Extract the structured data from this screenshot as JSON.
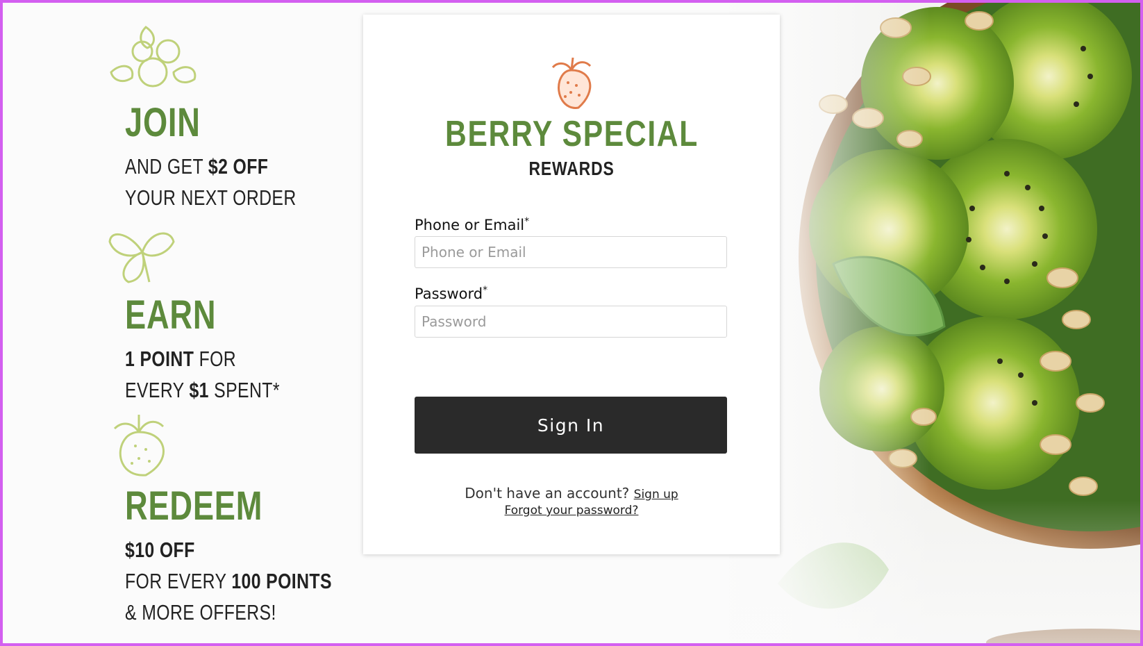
{
  "brand": {
    "title": "BERRY SPECIAL",
    "subtitle": "REWARDS",
    "logo_icon": "strawberry-icon",
    "accent_color": "#5d8a3c",
    "logo_color": "#e07b4a"
  },
  "promo": {
    "join": {
      "heading": "JOIN",
      "line1_a": "AND GET ",
      "line1_b": "$2 OFF",
      "line2": "YOUR NEXT ORDER",
      "icon": "blueberry-icon"
    },
    "earn": {
      "heading": "EARN",
      "line1_a": "1 POINT",
      "line1_b": " FOR",
      "line2_a": "EVERY ",
      "line2_b": "$1",
      "line2_c": " SPENT*",
      "icon": "leaf-icon"
    },
    "redeem": {
      "heading": "REDEEM",
      "line1": "$10 OFF",
      "line2_a": "FOR EVERY ",
      "line2_b": "100 POINTS",
      "line3": "& MORE OFFERS!",
      "icon": "strawberry-icon"
    }
  },
  "form": {
    "phone_label": "Phone or Email",
    "phone_placeholder": "Phone or Email",
    "password_label": "Password",
    "password_placeholder": "Password",
    "required_mark": "*",
    "signin_label": "Sign In",
    "no_account_text": "Don't have an account? ",
    "signup_link": "Sign up",
    "forgot_link": "Forgot your password?"
  }
}
